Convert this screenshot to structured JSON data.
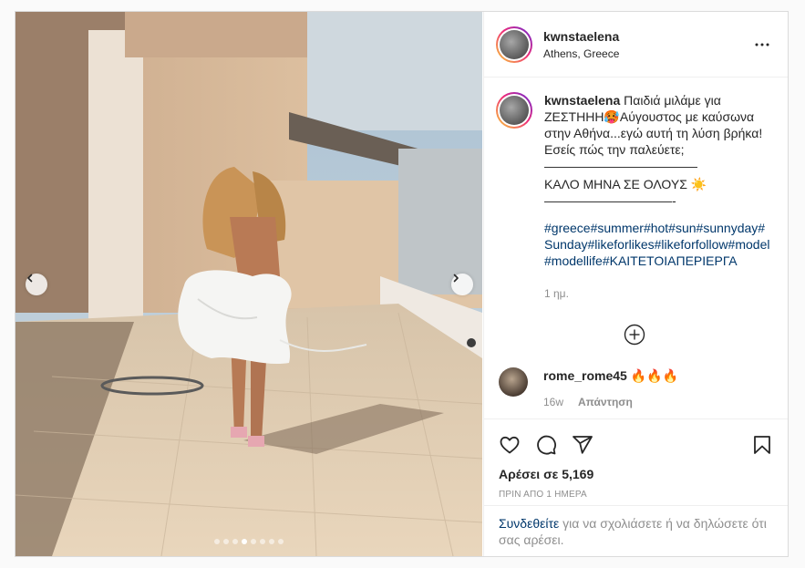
{
  "post": {
    "author": "kwnstaelena",
    "location": "Athens, Greece",
    "more_icon": "more-horizontal-icon",
    "carousel": {
      "slide_count": 8,
      "active_index": 3,
      "prev_icon": "chevron-left-icon",
      "next_icon": "chevron-right-icon"
    }
  },
  "caption": {
    "username": "kwnstaelena",
    "lines": [
      "Παιδιά μιλάμε για ΖΕΣΤΗΗΗ🥵Αύγουστος με καύσωνα στην Αθήνα...εγώ αυτή τη λύση βρήκα! Εσείς πώς την παλεύετε;",
      "————————————",
      "ΚΑΛΟ ΜΗΝΑ ΣΕ ΟΛΟΥΣ ☀️",
      "——————————-"
    ],
    "hashtags": "#greece#summer#hot#sun#sunnyday#Sunday#likeforlikes#likeforfollow#model#modellife#ΚΑΙΤΕΤΟΙΑΠΕΡΙΕΡΓΑ",
    "time": "1 ημ."
  },
  "load_more_icon": "plus-circle-icon",
  "comments": [
    {
      "username": "rome_rome45",
      "text": "🔥🔥🔥",
      "time": "16w",
      "reply_label": "Απάντηση"
    }
  ],
  "actions": {
    "like_icon": "heart-icon",
    "comment_icon": "comment-icon",
    "share_icon": "share-icon",
    "save_icon": "bookmark-icon",
    "likes_text": "Αρέσει σε 5,169",
    "date_text": "ΠΡΙΝ ΑΠΟ 1 ΗΜΕΡΑ"
  },
  "login": {
    "link_text": "Συνδεθείτε",
    "rest_text": " για να σχολιάσετε ή να δηλώσετε ότι σας αρέσει."
  },
  "colors": {
    "link": "#00376b",
    "secondary": "#8e8e8e",
    "border": "#dbdbdb"
  }
}
